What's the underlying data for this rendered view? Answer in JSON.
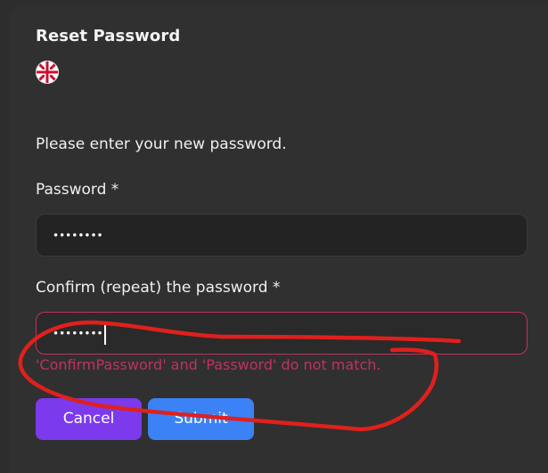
{
  "dialog": {
    "title": "Reset Password",
    "language_icon": "uk-flag-icon"
  },
  "form": {
    "instruction": "Please enter your new password.",
    "password": {
      "label": "Password *",
      "value": "••••••••"
    },
    "confirm_password": {
      "label": "Confirm (repeat) the password *",
      "value": "••••••••",
      "error": "'ConfirmPassword' and 'Password' do not match."
    }
  },
  "actions": {
    "cancel_label": "Cancel",
    "submit_label": "Submit"
  },
  "colors": {
    "background": "#303030",
    "input_background": "#232323",
    "error": "#c0325f",
    "cancel_button": "#7c3aed",
    "submit_button": "#3b82f6",
    "annotation": "#e0201c"
  }
}
